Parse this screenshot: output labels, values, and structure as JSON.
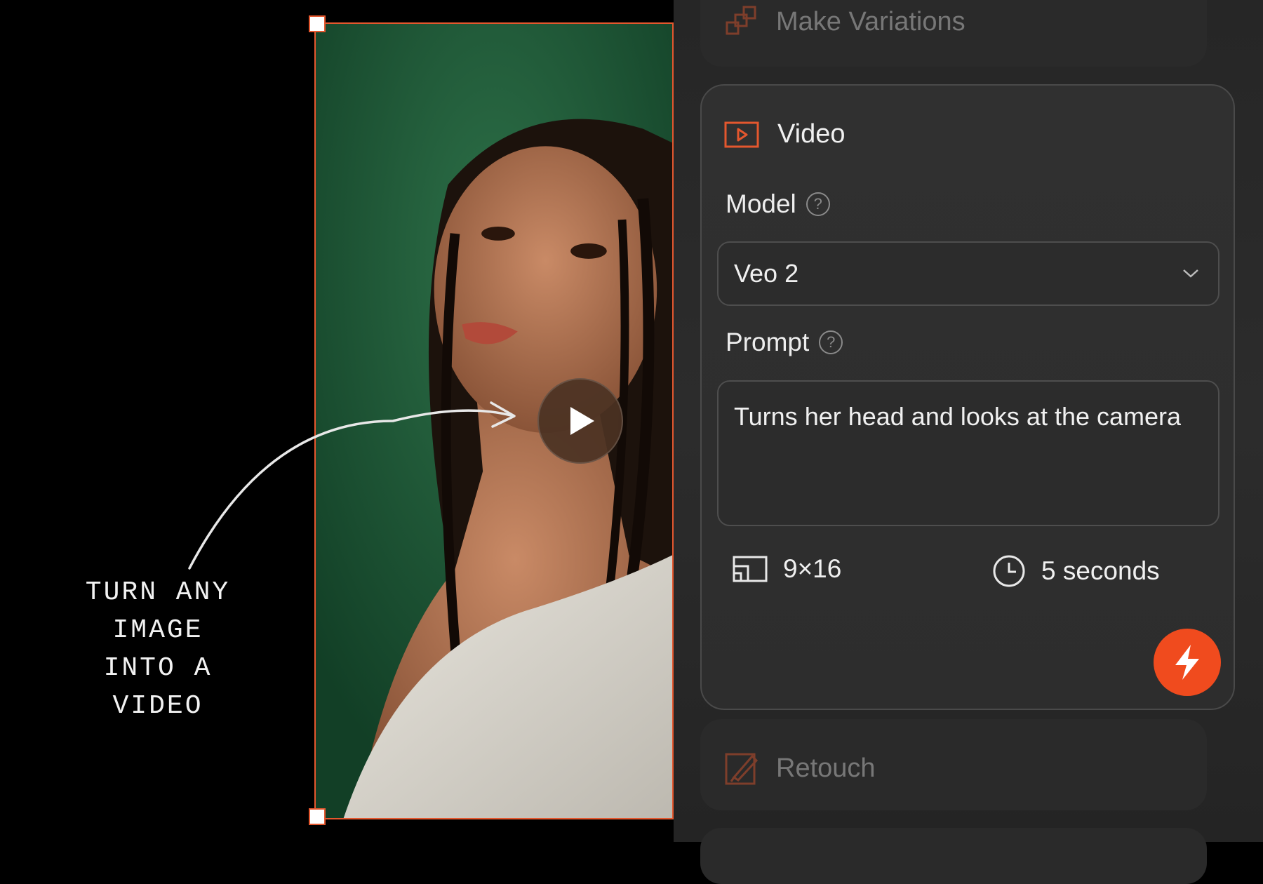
{
  "caption": {
    "text": "TURN ANY\nIMAGE\nINTO A\nVIDEO"
  },
  "panel": {
    "make_variations_label": "Make Variations",
    "video_card": {
      "title": "Video",
      "model_label": "Model",
      "model_value": "Veo 2",
      "prompt_label": "Prompt",
      "prompt_value": "Turns her head and looks at the camera",
      "aspect_ratio": "9×16",
      "duration": "5 seconds"
    },
    "retouch_label": "Retouch"
  },
  "colors": {
    "accent": "#e4572e",
    "generate": "#f04b1e",
    "panel_bg": "#2a2a2a",
    "photo_bg": "#1f5a3a"
  },
  "icons": {
    "make_variations": "stacked-squares-icon",
    "video": "play-rectangle-icon",
    "help": "question-circle-icon",
    "dropdown": "chevron-down-icon",
    "aspect_ratio": "aspect-ratio-icon",
    "duration": "clock-icon",
    "generate": "lightning-icon",
    "retouch": "retouch-brush-icon",
    "play": "play-icon"
  }
}
